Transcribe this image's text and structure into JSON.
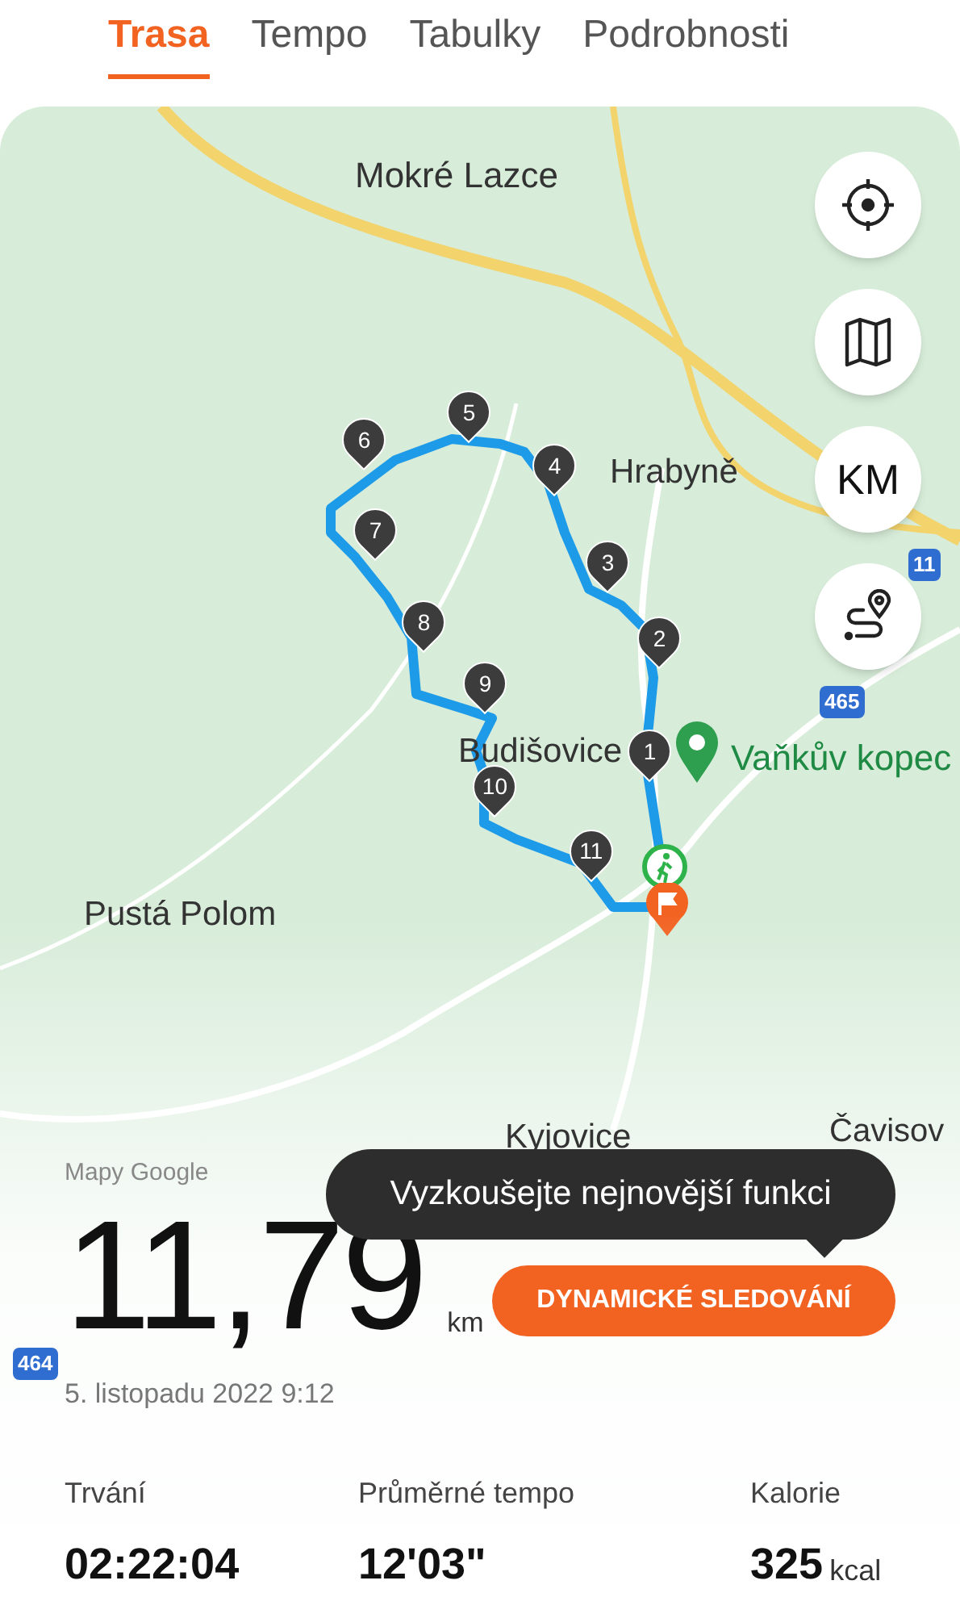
{
  "tabs": [
    {
      "label": "Trasa",
      "selected": true
    },
    {
      "label": "Tempo",
      "selected": false
    },
    {
      "label": "Tabulky",
      "selected": false
    },
    {
      "label": "Podrobnosti",
      "selected": false
    }
  ],
  "map": {
    "places": [
      {
        "label": "Mokré Lazce"
      },
      {
        "label": "Hrabyně"
      },
      {
        "label": "Budišovice"
      },
      {
        "label": "Pustá Polom"
      },
      {
        "label": "Kyjovice"
      },
      {
        "label": "Čavisov"
      }
    ],
    "road_badges": [
      "11",
      "465",
      "464"
    ],
    "km_markers": [
      "1",
      "2",
      "3",
      "4",
      "5",
      "6",
      "7",
      "8",
      "9",
      "10",
      "11"
    ],
    "poi": "Vaňkův kopec",
    "controls": [
      {
        "kind": "locate"
      },
      {
        "kind": "layers"
      },
      {
        "kind": "units",
        "label": "KM"
      },
      {
        "kind": "route"
      }
    ],
    "attribution": "Mapy Google"
  },
  "summary": {
    "distance": "11,79",
    "unit": "km",
    "date": "5. listopadu 2022 9:12",
    "tooltip": "Vyzkoušejte nejnovější funkci",
    "button": "DYNAMICKÉ SLEDOVÁNÍ"
  },
  "stats": [
    {
      "label": "Trvání",
      "value": "02:22:04"
    },
    {
      "label": "Průměrné tempo",
      "value": "12'03\""
    },
    {
      "label": "Kalorie",
      "value": "325",
      "unit": "kcal"
    }
  ]
}
